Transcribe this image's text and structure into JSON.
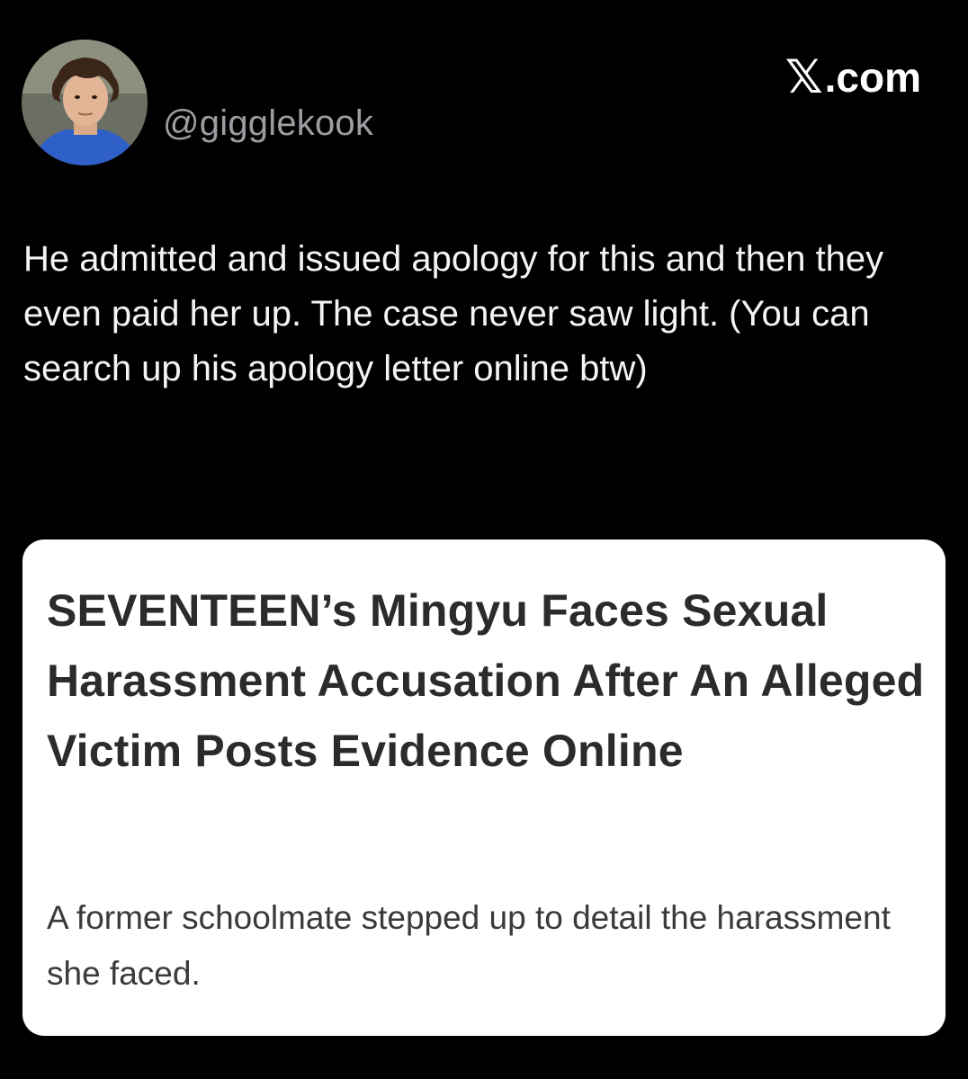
{
  "tweet": {
    "handle": "@gigglekook",
    "brand_mark": "𝕏",
    "brand_suffix": ".com",
    "text": "He admitted and issued apology for this and then they even paid her up. The case never saw light. (You can search up his apology letter online btw)"
  },
  "card": {
    "title": "SEVENTEEN’s Mingyu Faces Sexual Harassment Accusation After An Alleged Victim Posts Evidence Online",
    "description": "A former schoolmate stepped up to detail the harassment she faced."
  },
  "icons": {
    "avatar": "user-avatar-photo",
    "brand": "x-logo-icon"
  },
  "colors": {
    "background": "#000000",
    "handle": "#9a9da1",
    "card_bg": "#ffffff",
    "card_title": "#2b2b2b"
  }
}
